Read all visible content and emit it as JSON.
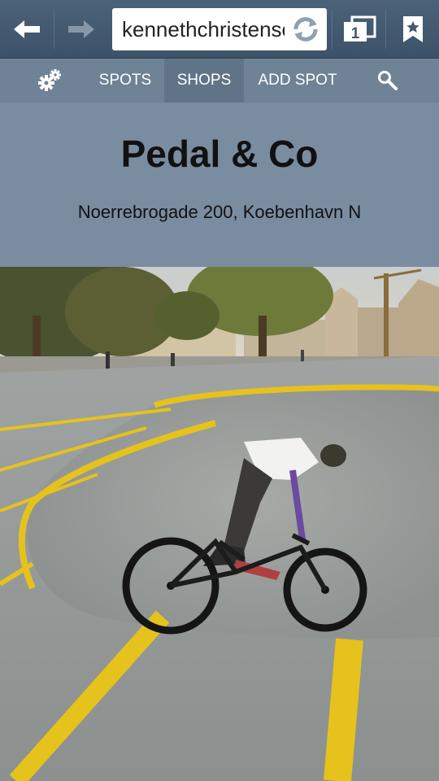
{
  "browser": {
    "url": "kennethchristensen",
    "icons": [
      "back-arrow-icon",
      "forward-arrow-icon",
      "reload-icon",
      "tabs-icon",
      "bookmark-icon"
    ],
    "tab_count": "1"
  },
  "nav": {
    "items": [
      {
        "label": "SPOTS"
      },
      {
        "label": "SHOPS",
        "active": true
      },
      {
        "label": "ADD SPOT"
      }
    ],
    "icons": [
      "gear-icon",
      "search-icon"
    ]
  },
  "shop": {
    "name": "Pedal & Co",
    "address": "Noerrebrogade 200, Koebenhavn N"
  },
  "photo": {
    "subject": "bmx-rider-in-skate-bowl"
  },
  "colors": {
    "toolbar": "#44596e",
    "nav": "#6f8296",
    "nav_active": "#617487",
    "header": "#7a8ca0",
    "concrete": "#a9aca9",
    "yellow_line": "#e6c21c"
  }
}
